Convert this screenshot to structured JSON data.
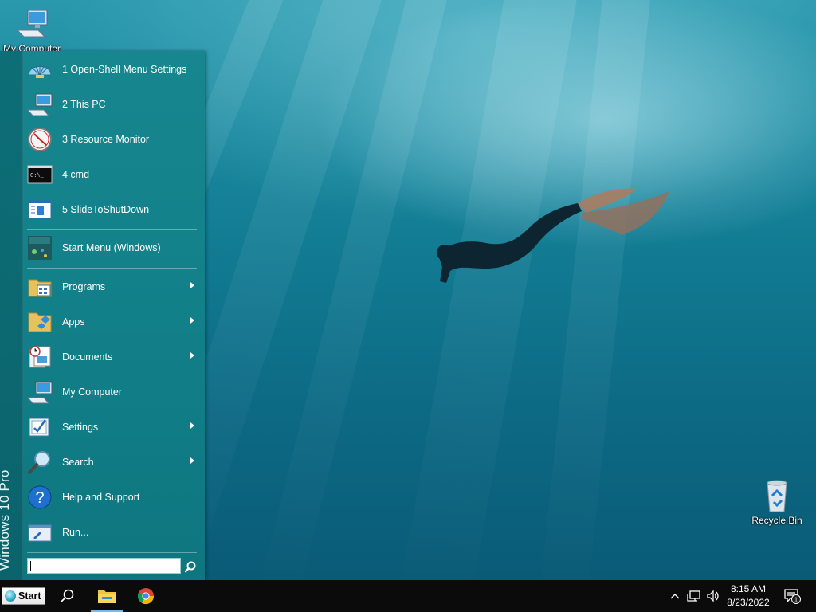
{
  "desktop": {
    "icons": [
      {
        "label": "My Computer"
      },
      {
        "label": "Recycle Bin"
      }
    ]
  },
  "start_menu": {
    "banner": "Windows 10 Pro",
    "pinned": [
      {
        "label": "1 Open-Shell Menu Settings",
        "icon": "shell-icon"
      },
      {
        "label": "2 This PC",
        "icon": "computer-icon"
      },
      {
        "label": "3 Resource Monitor",
        "icon": "gauge-icon"
      },
      {
        "label": "4 cmd",
        "icon": "terminal-icon"
      },
      {
        "label": "5 SlideToShutDown",
        "icon": "window-icon"
      }
    ],
    "windows_start": {
      "label": "Start Menu (Windows)",
      "icon": "start-tile-icon"
    },
    "main": [
      {
        "label": "Programs",
        "icon": "programs-folder-icon",
        "has_submenu": true
      },
      {
        "label": "Apps",
        "icon": "apps-folder-icon",
        "has_submenu": true
      },
      {
        "label": "Documents",
        "icon": "documents-icon",
        "has_submenu": true
      },
      {
        "label": "My Computer",
        "icon": "computer-icon",
        "has_submenu": false
      },
      {
        "label": "Settings",
        "icon": "settings-icon",
        "has_submenu": true
      },
      {
        "label": "Search",
        "icon": "magnifier-icon",
        "has_submenu": true
      },
      {
        "label": "Help and Support",
        "icon": "help-icon",
        "has_submenu": false
      },
      {
        "label": "Run...",
        "icon": "run-icon",
        "has_submenu": false
      }
    ],
    "search": {
      "value": ""
    }
  },
  "taskbar": {
    "start_label": "Start",
    "pinned_apps": [
      "search-icon",
      "file-explorer-icon",
      "chrome-icon"
    ],
    "tray": {
      "time": "8:15 AM",
      "date": "8/23/2022",
      "notification_count": "1"
    }
  },
  "colors": {
    "menu_bg": "#128089",
    "banner_bg": "#0d6e77",
    "taskbar_bg": "#0b0b0c",
    "explorer_underline": "#76b9ed"
  }
}
